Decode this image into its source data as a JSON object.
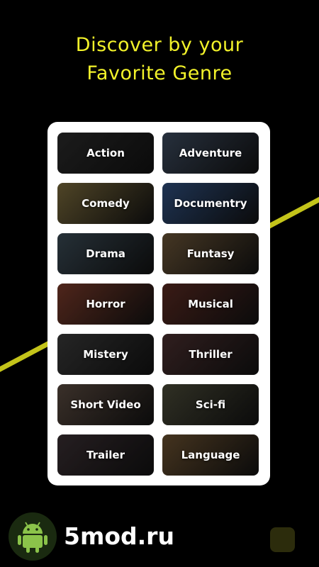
{
  "header": {
    "title_line1": "Discover by your",
    "title_line2": "Favorite Genre"
  },
  "colors": {
    "accent": "#f2f22a",
    "card_bg": "#ffffff",
    "page_bg": "#000000"
  },
  "genres": [
    {
      "label": "Action",
      "bg": "#2b2b2b"
    },
    {
      "label": "Adventure",
      "bg": "#3c4a5e"
    },
    {
      "label": "Comedy",
      "bg": "#7a6a3c"
    },
    {
      "label": "Documentry",
      "bg": "#2f4f7f"
    },
    {
      "label": "Drama",
      "bg": "#3a4a55"
    },
    {
      "label": "Funtasy",
      "bg": "#6b5538"
    },
    {
      "label": "Horror",
      "bg": "#7a3a2a"
    },
    {
      "label": "Musical",
      "bg": "#5a2a22"
    },
    {
      "label": "Mistery",
      "bg": "#3a3a3a"
    },
    {
      "label": "Thriller",
      "bg": "#4a2f2f"
    },
    {
      "label": "Short Video",
      "bg": "#5a4a40"
    },
    {
      "label": "Sci-fi",
      "bg": "#4a4a38"
    },
    {
      "label": "Trailer",
      "bg": "#3a2f33"
    },
    {
      "label": "Language",
      "bg": "#6a5030"
    }
  ],
  "watermark": {
    "text": "5mod.ru",
    "icon": "android-icon"
  }
}
